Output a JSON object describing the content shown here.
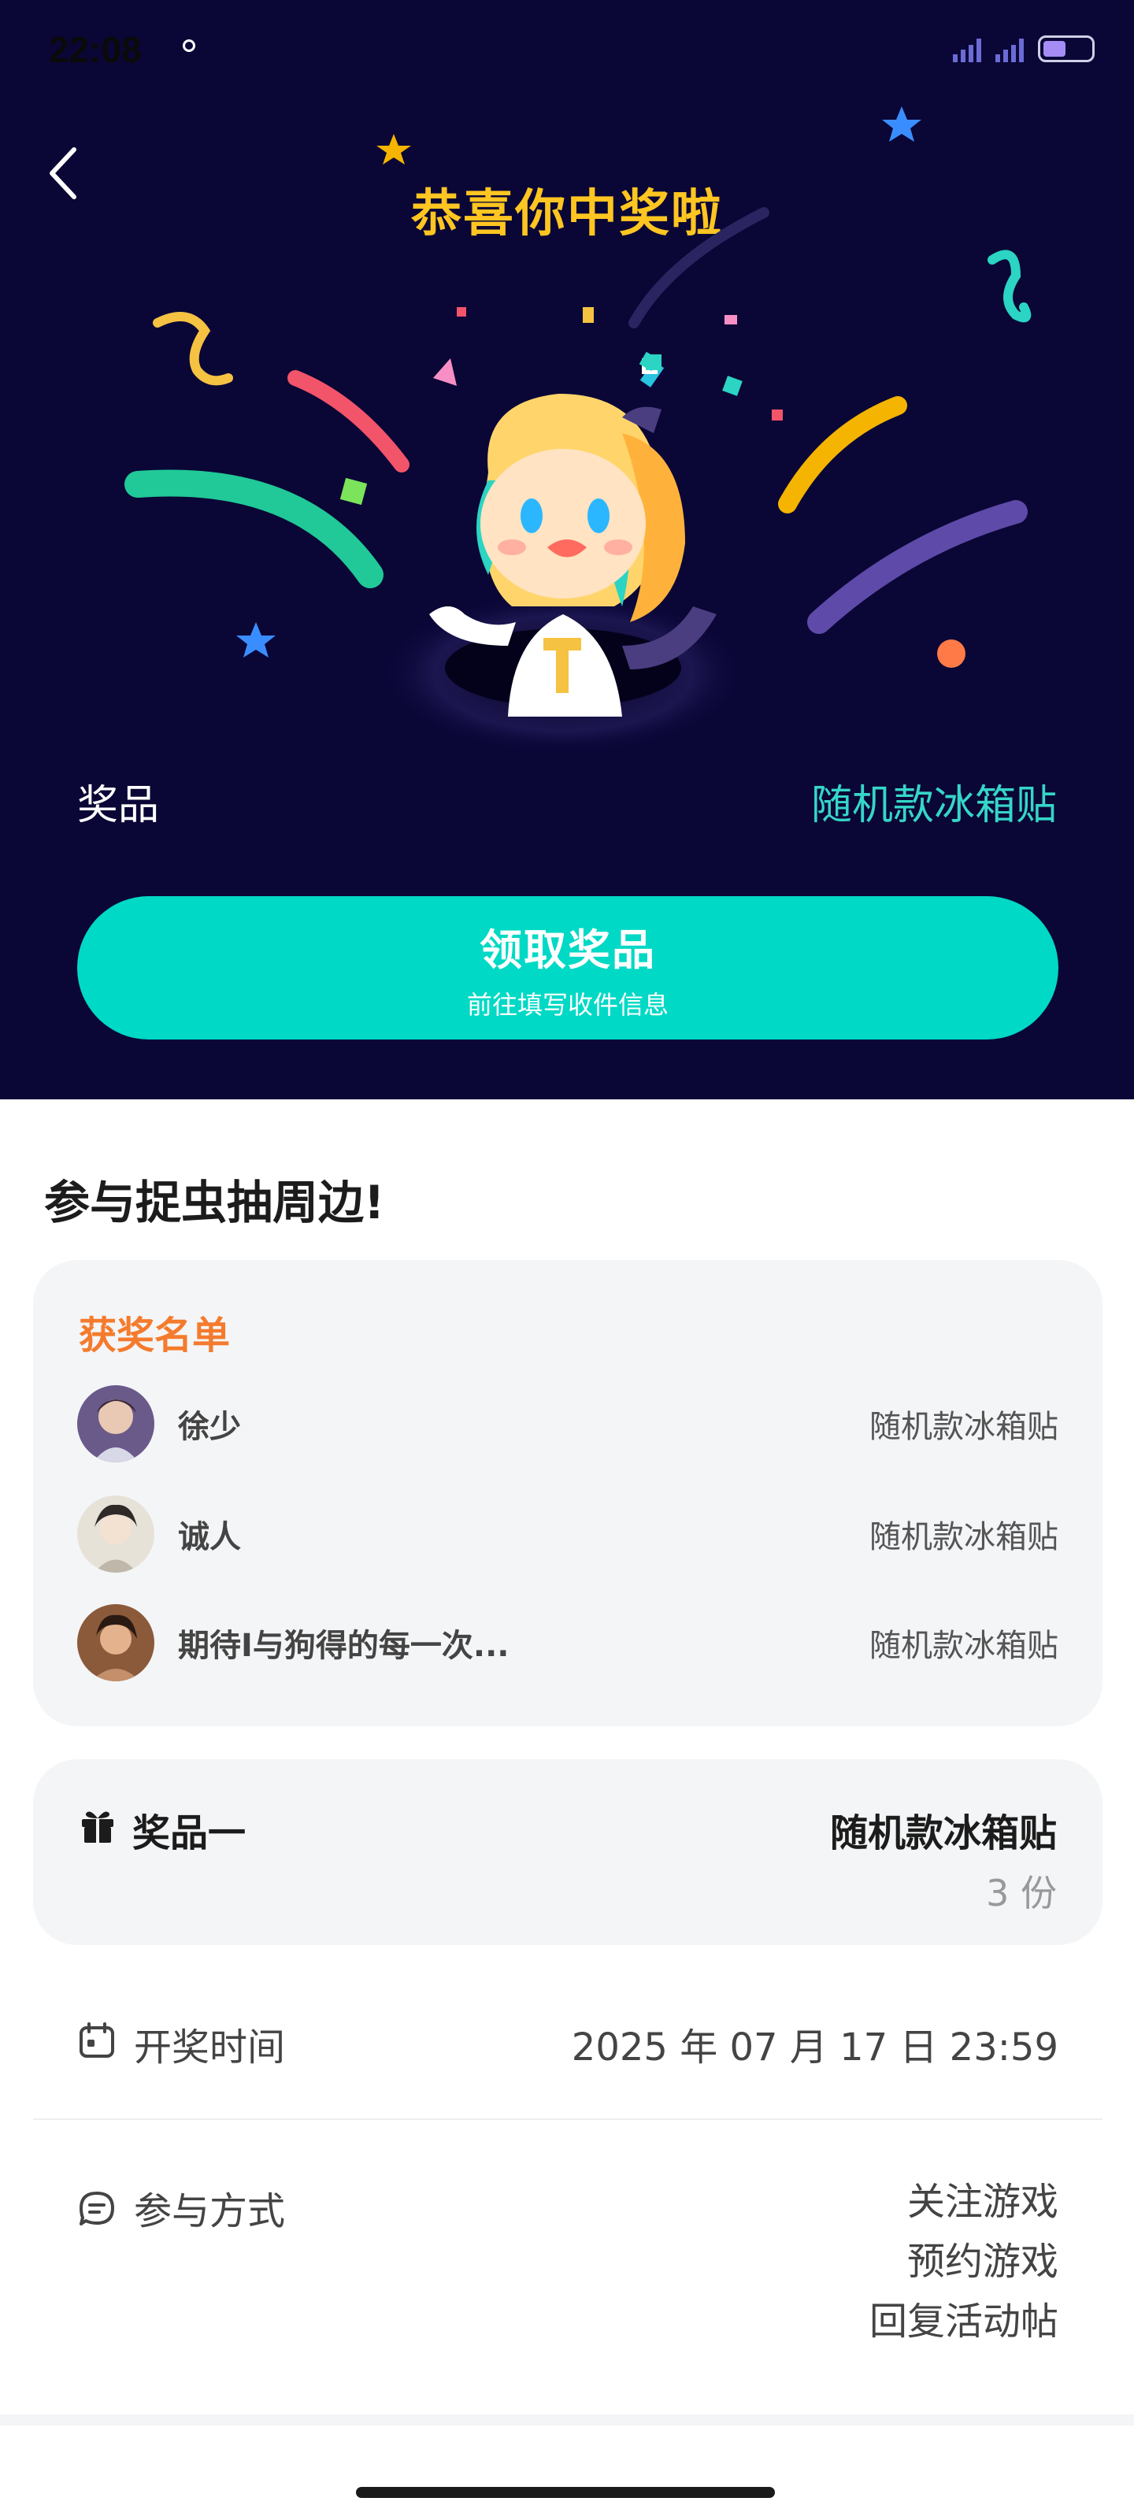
{
  "status_bar": {
    "time": "22:08"
  },
  "header": {
    "title": "恭喜你中奖啦"
  },
  "prize_summary": {
    "label": "奖品",
    "value": "随机款冰箱贴"
  },
  "claim_button": {
    "title": "领取奖品",
    "subtitle": "前往填写收件信息"
  },
  "activity": {
    "title": "参与捉虫抽周边!"
  },
  "winners": {
    "title": "获奖名单",
    "list": [
      {
        "name": "徐少",
        "prize": "随机款冰箱贴"
      },
      {
        "name": "诚人",
        "prize": "随机款冰箱贴"
      },
      {
        "name": "期待I与狗得的每一次...",
        "prize": "随机款冰箱贴"
      }
    ]
  },
  "prize_detail": {
    "label": "奖品一",
    "name": "随机款冰箱贴",
    "count": "3 份"
  },
  "draw_time": {
    "label": "开奖时间",
    "value": "2025 年 07 月 17 日 23:59"
  },
  "participation": {
    "label": "参与方式",
    "methods": [
      "关注游戏",
      "预约游戏",
      "回复活动帖"
    ]
  },
  "colors": {
    "hero_bg": "#0a0636",
    "title_yellow": "#ffc521",
    "accent_teal": "#00d9c5",
    "prize_teal": "#35d6c8",
    "winners_orange": "#f47b2d"
  },
  "icons": {
    "back": "chevron-left-icon",
    "gift": "gift-icon",
    "calendar": "calendar-icon",
    "chat": "chat-bubble-icon"
  }
}
